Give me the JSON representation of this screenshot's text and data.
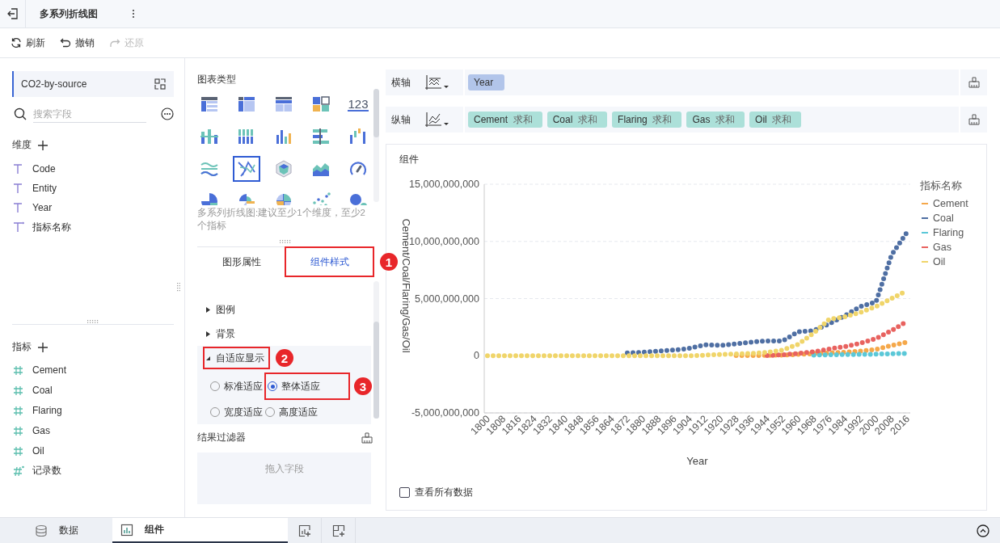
{
  "header": {
    "title": "多系列折线图"
  },
  "toolbar": [
    {
      "kind": "refresh",
      "label": "刷新",
      "disabled": false
    },
    {
      "kind": "undo",
      "label": "撤销",
      "disabled": false
    },
    {
      "kind": "redo",
      "label": "还原",
      "disabled": true
    }
  ],
  "dataset": {
    "name": "CO2-by-source"
  },
  "field_search": {
    "placeholder": "搜索字段"
  },
  "dimensions": {
    "title": "维度",
    "fields": [
      {
        "kind": "text",
        "label": "Code"
      },
      {
        "kind": "text",
        "label": "Entity"
      },
      {
        "kind": "text",
        "label": "Year"
      },
      {
        "kind": "text-calc",
        "label": "指标名称"
      }
    ]
  },
  "measures": {
    "title": "指标",
    "fields": [
      {
        "kind": "number",
        "label": "Cement"
      },
      {
        "kind": "number",
        "label": "Coal"
      },
      {
        "kind": "number",
        "label": "Flaring"
      },
      {
        "kind": "number",
        "label": "Gas"
      },
      {
        "kind": "number",
        "label": "Oil"
      },
      {
        "kind": "number-calc",
        "label": "记录数"
      }
    ]
  },
  "chart_type_panel": {
    "title": "图表类型",
    "hint": "多系列折线图:建议至少1个维度，至少2个指标",
    "types": [
      {
        "kind": "table",
        "selected": false
      },
      {
        "kind": "pivot",
        "selected": false
      },
      {
        "kind": "detail",
        "selected": false
      },
      {
        "kind": "tiles",
        "selected": false
      },
      {
        "kind": "kpi",
        "label": "123",
        "selected": false
      },
      {
        "kind": "grouped-column",
        "selected": false
      },
      {
        "kind": "stacked-column",
        "selected": false
      },
      {
        "kind": "column",
        "selected": false
      },
      {
        "kind": "bar",
        "selected": false
      },
      {
        "kind": "waterfall",
        "selected": false
      },
      {
        "kind": "waves",
        "selected": false
      },
      {
        "kind": "multi-line",
        "selected": true
      },
      {
        "kind": "radar",
        "selected": false
      },
      {
        "kind": "area",
        "selected": false
      },
      {
        "kind": "gauge",
        "selected": false
      },
      {
        "kind": "pie",
        "selected": false
      },
      {
        "kind": "rose",
        "selected": false
      },
      {
        "kind": "globe",
        "selected": false
      },
      {
        "kind": "scatter",
        "selected": false
      },
      {
        "kind": "bubble",
        "selected": false
      }
    ]
  },
  "property_tabs": [
    {
      "label": "图形属性",
      "selected": false
    },
    {
      "label": "组件样式",
      "selected": true,
      "callout": "1"
    }
  ],
  "property_sections": [
    {
      "label": "图例",
      "expanded": false
    },
    {
      "label": "背景",
      "expanded": false
    },
    {
      "label": "自适应显示",
      "expanded": true,
      "callout": "2",
      "options": [
        {
          "label": "标准适应",
          "selected": false
        },
        {
          "label": "整体适应",
          "selected": true,
          "callout": "3"
        },
        {
          "label": "宽度适应",
          "selected": false
        },
        {
          "label": "高度适应",
          "selected": false
        }
      ]
    }
  ],
  "result_filter": {
    "title": "结果过滤器",
    "dropzone": "拖入字段"
  },
  "x_axis": {
    "label": "横轴",
    "fields": [
      {
        "name": "Year"
      }
    ]
  },
  "y_axis": {
    "label": "纵轴",
    "fields": [
      {
        "name": "Cement",
        "aggregation": "求和"
      },
      {
        "name": "Coal",
        "aggregation": "求和"
      },
      {
        "name": "Flaring",
        "aggregation": "求和"
      },
      {
        "name": "Gas",
        "aggregation": "求和"
      },
      {
        "name": "Oil",
        "aggregation": "求和"
      }
    ]
  },
  "component": {
    "title": "组件",
    "view_all": {
      "label": "查看所有数据",
      "checked": false
    },
    "chart_data": {
      "type": "line",
      "xlabel": "Year",
      "ylabel": "Cement/Coal/Flaring/Gas/Oil",
      "categories": [
        "1800",
        "1808",
        "1816",
        "1824",
        "1832",
        "1840",
        "1848",
        "1856",
        "1864",
        "1872",
        "1880",
        "1888",
        "1896",
        "1904",
        "1912",
        "1920",
        "1928",
        "1936",
        "1944",
        "1952",
        "1960",
        "1968",
        "1976",
        "1984",
        "1992",
        "2000",
        "2008",
        "2016"
      ],
      "ylim": [
        -5000000000.0,
        15000000000.0
      ],
      "legend": {
        "title": "指标名称"
      },
      "yticks": [
        {
          "value": -5000000000.0,
          "label": "-5,000,000,000"
        },
        {
          "value": 0,
          "label": "0"
        },
        {
          "value": 5000000000.0,
          "label": "5,000,000,000"
        },
        {
          "value": 10000000000.0,
          "label": "10,000,000,000"
        },
        {
          "value": 15000000000.0,
          "label": "15,000,000,000"
        }
      ],
      "series": [
        {
          "name": "Cement",
          "color": "#f5a84a",
          "line_style": "dotted",
          "values": [
            null,
            null,
            null,
            null,
            null,
            null,
            null,
            null,
            null,
            null,
            null,
            null,
            null,
            null,
            null,
            null,
            10000000.0,
            20000000.0,
            30000000.0,
            60000000.0,
            120000000.0,
            180000000.0,
            250000000.0,
            300000000.0,
            400000000.0,
            550000000.0,
            900000000.0,
            1200000000.0
          ]
        },
        {
          "name": "Coal",
          "color": "#4f6fa3",
          "line_style": "dotted",
          "values": [
            null,
            null,
            null,
            null,
            null,
            null,
            null,
            null,
            null,
            250000000.0,
            300000000.0,
            400000000.0,
            500000000.0,
            650000000.0,
            950000000.0,
            900000000.0,
            1050000000.0,
            1200000000.0,
            1300000000.0,
            1300000000.0,
            2100000000.0,
            2200000000.0,
            2800000000.0,
            3500000000.0,
            4300000000.0,
            4700000000.0,
            8800000000.0,
            10800000000.0
          ]
        },
        {
          "name": "Flaring",
          "color": "#5bc8d8",
          "line_style": "dotted",
          "values": [
            null,
            null,
            null,
            null,
            null,
            null,
            null,
            null,
            null,
            null,
            null,
            null,
            null,
            null,
            null,
            null,
            null,
            null,
            null,
            null,
            null,
            50000000.0,
            80000000.0,
            100000000.0,
            120000000.0,
            140000000.0,
            170000000.0,
            200000000.0
          ]
        },
        {
          "name": "Gas",
          "color": "#e8625f",
          "line_style": "dotted",
          "values": [
            null,
            null,
            null,
            null,
            null,
            null,
            null,
            null,
            null,
            null,
            null,
            null,
            null,
            null,
            null,
            null,
            null,
            null,
            20000000.0,
            80000000.0,
            200000000.0,
            350000000.0,
            600000000.0,
            800000000.0,
            1100000000.0,
            1500000000.0,
            2200000000.0,
            3000000000.0
          ]
        },
        {
          "name": "Oil",
          "color": "#f0d56a",
          "line_style": "dotted",
          "values": [
            0,
            0,
            0,
            0,
            0,
            0,
            0,
            0,
            0,
            0,
            0,
            0,
            0,
            0,
            50000000.0,
            100000000.0,
            150000000.0,
            200000000.0,
            300000000.0,
            500000000.0,
            1000000000.0,
            2000000000.0,
            3200000000.0,
            3400000000.0,
            3800000000.0,
            4300000000.0,
            5000000000.0,
            5700000000.0
          ]
        }
      ]
    }
  },
  "bottom_tabs": [
    {
      "kind": "data",
      "label": "数据",
      "selected": false
    },
    {
      "kind": "component",
      "label": "组件",
      "selected": true
    }
  ]
}
